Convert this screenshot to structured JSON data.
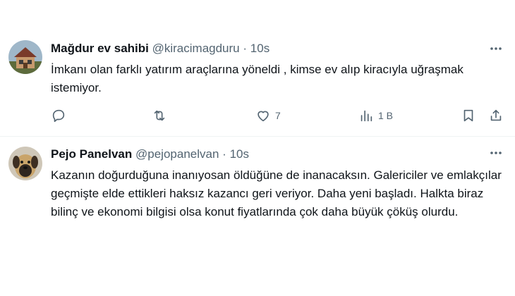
{
  "tweets": [
    {
      "author_name": "Mağdur ev sahibi",
      "author_handle": "@kiracimagduru",
      "separator": "·",
      "time": "10s",
      "text": "İmkanı olan farklı yatırım araçlarına yöneldi , kimse ev alıp kiracıyla uğraşmak istemiyor.",
      "likes": "7",
      "views": "1 B"
    },
    {
      "author_name": "Pejo Panelvan",
      "author_handle": "@pejopanelvan",
      "separator": "·",
      "time": "10s",
      "text": "Kazanın doğurduğuna inanıyosan öldüğüne de inanacaksın. Galericiler ve emlakçılar geçmişte elde ettikleri haksız kazancı geri veriyor. Daha yeni başladı. Halkta biraz bilinç ve ekonomi bilgisi olsa konut fiyatlarında çok daha büyük çöküş olurdu."
    }
  ],
  "icons": {
    "reply": "reply-icon",
    "retweet": "retweet-icon",
    "like": "heart-icon",
    "views": "views-icon",
    "bookmark": "bookmark-icon",
    "share": "share-icon",
    "more": "more-icon"
  },
  "colors": {
    "text": "#0f1419",
    "secondary": "#536471",
    "divider": "#eff3f4"
  }
}
